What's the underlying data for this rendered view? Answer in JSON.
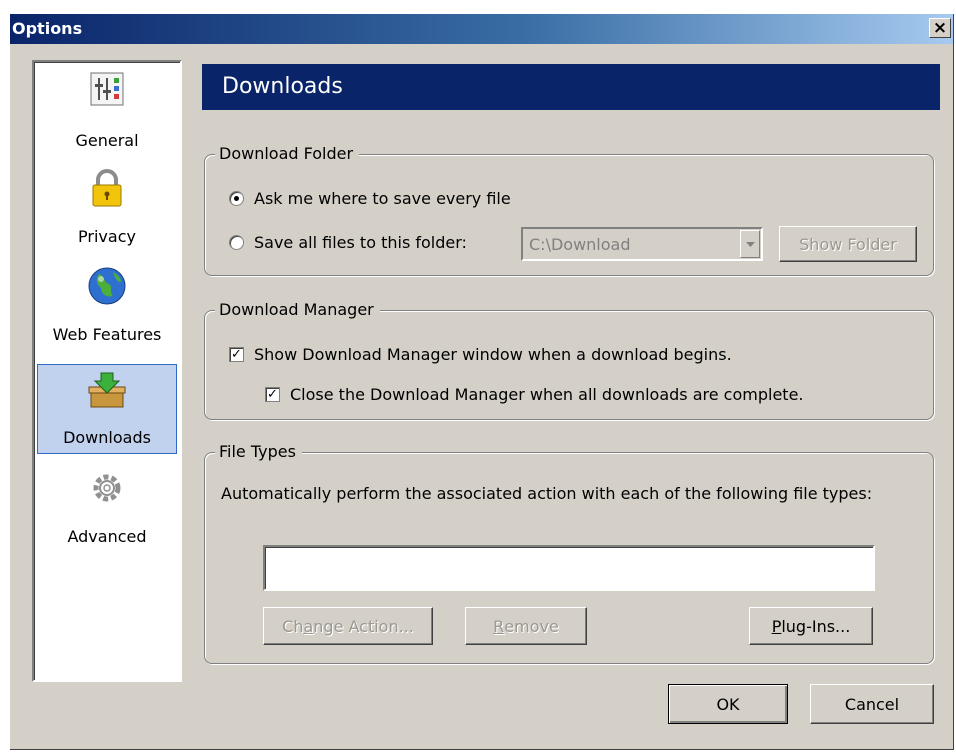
{
  "window": {
    "title": "Options",
    "close_glyph": "×"
  },
  "sidebar": {
    "items": [
      {
        "label": "General",
        "icon": "general-sliders-icon",
        "selected": false
      },
      {
        "label": "Privacy",
        "icon": "padlock-icon",
        "selected": false
      },
      {
        "label": "Web Features",
        "icon": "globe-icon",
        "selected": false
      },
      {
        "label": "Downloads",
        "icon": "download-box-icon",
        "selected": true
      },
      {
        "label": "Advanced",
        "icon": "gears-icon",
        "selected": false
      }
    ]
  },
  "panel": {
    "title": "Downloads"
  },
  "download_folder": {
    "legend": "Download Folder",
    "ask_label": "Ask me where to save every file",
    "ask_selected": true,
    "save_label": "Save all files to this folder:",
    "save_selected": false,
    "folder_value": "C:\\Download",
    "show_folder_label": "Show Folder"
  },
  "download_manager": {
    "legend": "Download Manager",
    "show_window_label": "Show Download Manager window when a download begins.",
    "show_window_checked": true,
    "close_when_done_label": "Close the Download Manager when all downloads are complete.",
    "close_when_done_checked": true
  },
  "file_types": {
    "legend": "File Types",
    "description": "Automatically perform the associated action with each of the following file types:",
    "change_action": {
      "before": "Ch",
      "accel": "a",
      "after": "nge Action..."
    },
    "remove": {
      "before": "",
      "accel": "R",
      "after": "emove"
    },
    "plugins": {
      "before": "",
      "accel": "P",
      "after": "lug-Ins..."
    }
  },
  "footer": {
    "ok_label": "OK",
    "cancel_label": "Cancel"
  },
  "colors": {
    "titlebar": "#0a246a",
    "header": "#0a246a",
    "face": "#d4d0c8",
    "selection": "#c1d2ee"
  }
}
